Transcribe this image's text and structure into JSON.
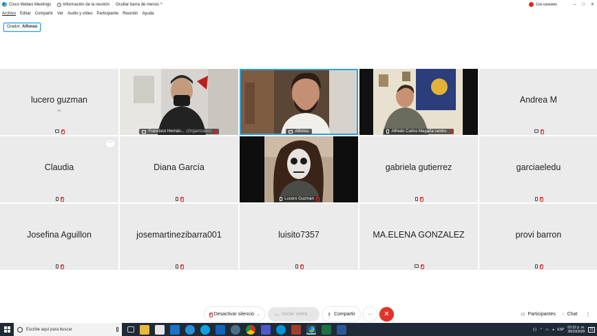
{
  "titlebar": {
    "app_title": "Cisco Webex Meetings",
    "meeting_info": "Información de la reunión",
    "hide_menu": "Ocultar barra de menús",
    "connection": "Con conexión",
    "controls": [
      "–",
      "□",
      "✕"
    ]
  },
  "menu": [
    "Archivo",
    "Editar",
    "Compartir",
    "Ver",
    "Audio y vídeo",
    "Participante",
    "Reunión",
    "Ayuda"
  ],
  "speaker": {
    "prefix": "Orador:",
    "name": "Alfonso"
  },
  "tiles": [
    {
      "name": "lucero guzman",
      "sub": "yo",
      "device": "pc",
      "type": "name"
    },
    {
      "name": "Francisco Hernán...",
      "tag": "(Organizador)",
      "device": "pc",
      "type": "video"
    },
    {
      "name": "Alfonso",
      "device": "pc",
      "type": "video",
      "active": true
    },
    {
      "name": "Alfredo Carlos Magaña ramiro",
      "device": "phone",
      "type": "video"
    },
    {
      "name": "Andrea M",
      "device": "pc",
      "type": "name"
    },
    {
      "name": "Claudia",
      "device": "phone",
      "type": "name",
      "more": "···"
    },
    {
      "name": "Diana García",
      "device": "phone",
      "type": "name"
    },
    {
      "name": "Lucero Guzman",
      "device": "phone",
      "type": "video"
    },
    {
      "name": "gabriela gutierrez",
      "device": "phone",
      "type": "name"
    },
    {
      "name": "garciaeledu",
      "device": "phone",
      "type": "name"
    },
    {
      "name": "Josefina Aguillon",
      "device": "phone",
      "type": "name"
    },
    {
      "name": "josemartinezibarra001",
      "device": "phone",
      "type": "name"
    },
    {
      "name": "luisito7357",
      "device": "phone",
      "type": "name"
    },
    {
      "name": "MA.ELENA GONZALEZ",
      "device": "pc",
      "type": "name"
    },
    {
      "name": "provi barron",
      "device": "phone",
      "type": "name"
    }
  ],
  "controls": {
    "unmute": "Desactivar silencio",
    "start_video": "Iniciar vídeo",
    "share": "Compartir",
    "more": "···",
    "end": "✕",
    "participants": "Participantes",
    "chat": "Chat"
  },
  "taskbar": {
    "search_placeholder": "Escribe aquí para buscar",
    "lang": "ESP",
    "time": "03:32 p. m.",
    "date": "28/10/2020",
    "notifications": "21"
  },
  "colors": {
    "accent": "#2aa1e0",
    "end_call": "#e0332a",
    "muted_mic": "#dd2222",
    "taskbar": "#1f2a36"
  }
}
